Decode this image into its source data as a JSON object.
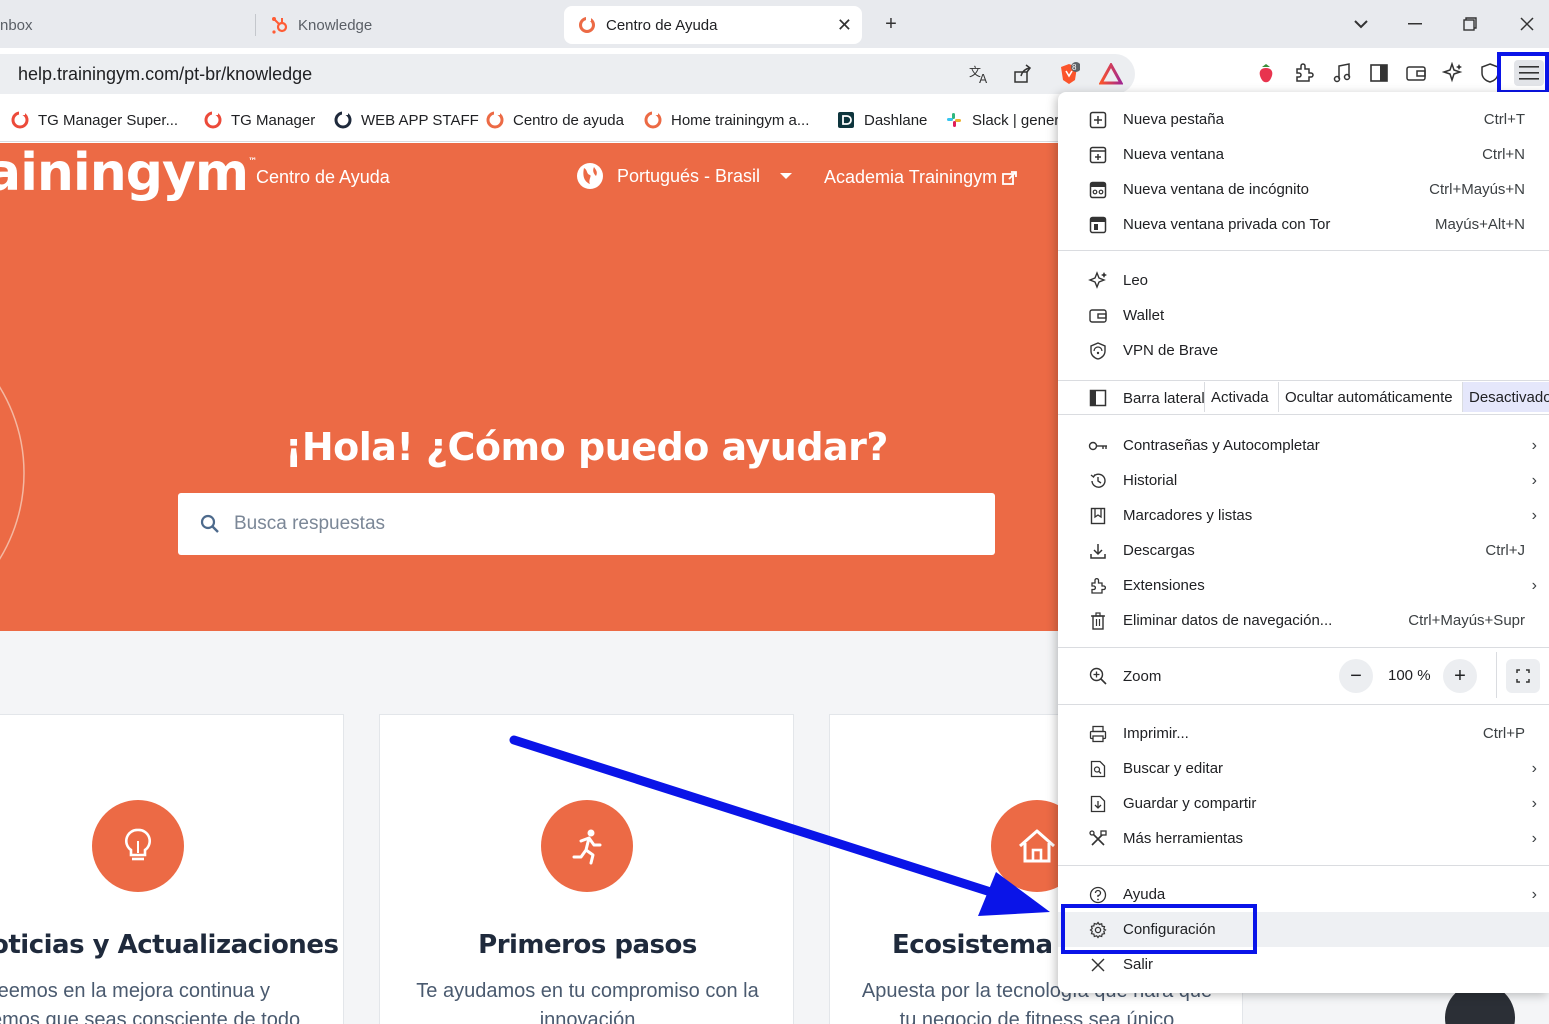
{
  "tabs": [
    {
      "label": "nbox"
    },
    {
      "label": "Knowledge"
    },
    {
      "label": "Centro de Ayuda",
      "active": true
    }
  ],
  "address": {
    "url": "help.trainingym.com/pt-br/knowledge"
  },
  "extension_badge": "8",
  "bookmarks": [
    {
      "label": "TG Manager Super..."
    },
    {
      "label": "TG Manager"
    },
    {
      "label": "WEB APP STAFF"
    },
    {
      "label": "Centro de ayuda"
    },
    {
      "label": "Home trainingym a..."
    },
    {
      "label": "Dashlane"
    },
    {
      "label": "Slack | genera"
    }
  ],
  "site": {
    "logo": "ainingym",
    "logo_tm": "™",
    "nav": {
      "help_center": "Centro de Ayuda",
      "language": "Portugués - Brasil",
      "academy": "Academia Trainingym"
    },
    "hero_title": "¡Hola! ¿Cómo puedo ayudar?",
    "search_placeholder": "Busca respuestas",
    "cards": [
      {
        "title": "oticias y Actualizaciones",
        "line1": "reemos en la mejora continua y",
        "line2": "emos que seas consciente de todo"
      },
      {
        "title": "Primeros pasos",
        "line1": "Te ayudamos en tu compromiso con la",
        "line2": "innovación"
      },
      {
        "title": "Ecosistema T",
        "line1": "Apuesta por la tecnología que hará que",
        "line2": "tu negocio de fitness sea único"
      }
    ]
  },
  "menu": {
    "group1": [
      {
        "label": "Nueva pestaña",
        "shortcut": "Ctrl+T",
        "icon": "new-tab-icon"
      },
      {
        "label": "Nueva ventana",
        "shortcut": "Ctrl+N",
        "icon": "new-window-icon"
      },
      {
        "label": "Nueva ventana de incógnito",
        "shortcut": "Ctrl+Mayús+N",
        "icon": "incognito-icon"
      },
      {
        "label": "Nueva ventana privada con Tor",
        "shortcut": "Mayús+Alt+N",
        "icon": "tor-icon"
      }
    ],
    "group2": [
      {
        "label": "Leo",
        "icon": "leo-icon"
      },
      {
        "label": "Wallet",
        "icon": "wallet-icon"
      },
      {
        "label": "VPN de Brave",
        "icon": "vpn-icon"
      }
    ],
    "sidebar": {
      "label": "Barra lateral",
      "options": [
        "Activada",
        "Ocultar automáticamente",
        "Desactivado"
      ],
      "selected": "Desactivado"
    },
    "group3": [
      {
        "label": "Contraseñas y Autocompletar",
        "chevron": "›",
        "icon": "key-icon"
      },
      {
        "label": "Historial",
        "chevron": "›",
        "icon": "history-icon"
      },
      {
        "label": "Marcadores y listas",
        "chevron": "›",
        "icon": "bookmarks-icon"
      },
      {
        "label": "Descargas",
        "shortcut": "Ctrl+J",
        "icon": "download-icon"
      },
      {
        "label": "Extensiones",
        "chevron": "›",
        "icon": "extensions-icon"
      },
      {
        "label": "Eliminar datos de navegación...",
        "shortcut": "Ctrl+Mayús+Supr",
        "icon": "trash-icon"
      }
    ],
    "zoom": {
      "label": "Zoom",
      "minus": "−",
      "value": "100 %",
      "plus": "+"
    },
    "group4": [
      {
        "label": "Imprimir...",
        "shortcut": "Ctrl+P",
        "icon": "print-icon"
      },
      {
        "label": "Buscar y editar",
        "chevron": "›",
        "icon": "find-icon"
      },
      {
        "label": "Guardar y compartir",
        "chevron": "›",
        "icon": "save-share-icon"
      },
      {
        "label": "Más herramientas",
        "chevron": "›",
        "icon": "tools-icon"
      }
    ],
    "group5": [
      {
        "label": "Ayuda",
        "chevron": "›",
        "icon": "help-icon"
      },
      {
        "label": "Configuración",
        "icon": "gear-icon"
      },
      {
        "label": "Salir",
        "icon": "close-icon"
      }
    ]
  },
  "colors": {
    "brand": "#ec6a45",
    "annotation": "#0a14e8"
  }
}
